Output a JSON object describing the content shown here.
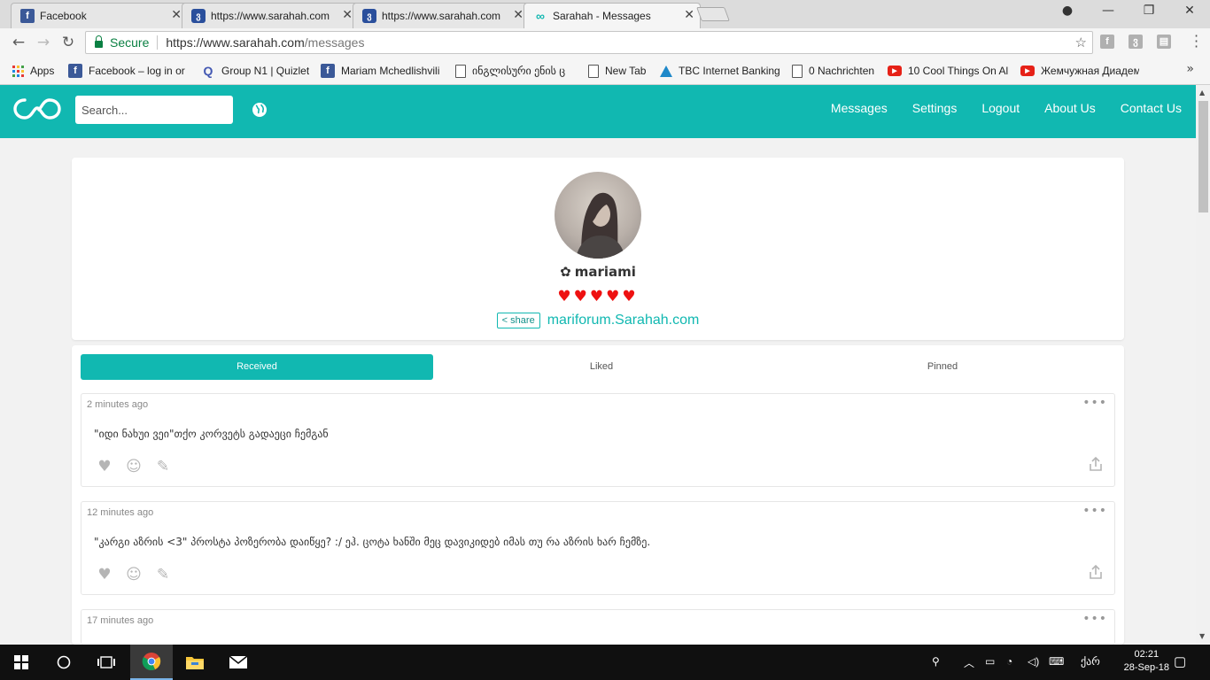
{
  "browser": {
    "tabs": [
      {
        "title": "Facebook",
        "icon": "facebook-icon"
      },
      {
        "title": "https://www.sarahah.com",
        "icon": "sarahah-icon"
      },
      {
        "title": "https://www.sarahah.com",
        "icon": "sarahah-icon"
      },
      {
        "title": "Sarahah - Messages",
        "icon": "infinity-icon"
      }
    ],
    "address": {
      "secure_label": "Secure",
      "url_host": "https://www.sarahah.com",
      "url_path": "/messages"
    },
    "bookmarks": [
      {
        "label": "Apps"
      },
      {
        "label": "Facebook – log in or s"
      },
      {
        "label": "Group N1 | Quizlet"
      },
      {
        "label": "Mariam Mchedlishvili"
      },
      {
        "label": "ინგლისური ენის ც"
      },
      {
        "label": "New Tab"
      },
      {
        "label": "TBC Internet Banking"
      },
      {
        "label": "0 Nachrichten"
      },
      {
        "label": "10 Cool Things On Al"
      },
      {
        "label": "Жемчужная Диадема"
      }
    ],
    "more_label": "»"
  },
  "header": {
    "search_placeholder": "Search...",
    "nav": [
      "Messages",
      "Settings",
      "Logout",
      "About Us",
      "Contact Us"
    ]
  },
  "profile": {
    "username": "mariami",
    "hearts": "♥♥♥♥♥",
    "share_label": "share",
    "link": "mariforum.Sarahah.com"
  },
  "tabs": [
    "Received",
    "Liked",
    "Pinned"
  ],
  "messages": [
    {
      "time": "2 minutes ago",
      "text": "\"იდი ნახუი ვეი\"თქო კორვეტს გადაეცი ჩემგან"
    },
    {
      "time": "12 minutes ago",
      "text": "\"კარგი აზრის <3\" პროსტა პოზერობა დაიწყე? :/ ეჰ. ცოტა ხანში მეც დავიკიდებ იმას თუ რა აზრის ხარ ჩემზე."
    },
    {
      "time": "17 minutes ago",
      "text": ""
    }
  ],
  "taskbar": {
    "time": "02:21",
    "date": "28-Sep-18",
    "lang": "ქარ"
  },
  "colors": {
    "brand": "#11b8b1",
    "heart": "#ee1111"
  }
}
